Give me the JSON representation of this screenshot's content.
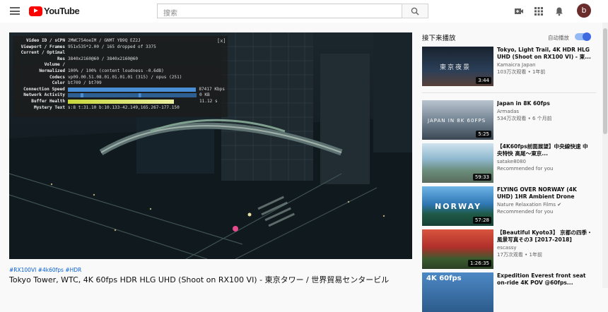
{
  "header": {
    "logo_text": "YouTube",
    "search_placeholder": "搜索",
    "avatar_letter": "b",
    "icons": [
      "menu-icon",
      "search-icon",
      "create-video-icon",
      "apps-grid-icon",
      "notifications-bell-icon"
    ]
  },
  "stats": {
    "close_label": "[x]",
    "rows": [
      {
        "key": "Video ID / sCPN",
        "value": "2MWC754oeIM / GNMT YB9Q EZ2J"
      },
      {
        "key": "Viewport / Frames",
        "value": "951x535*2.00 / 165 dropped of 3375"
      },
      {
        "key": "Current / Optimal",
        "value": ""
      },
      {
        "key": "Res",
        "value": "3840x2160@60 / 3840x2160@60"
      },
      {
        "key": "Volume /",
        "value": ""
      },
      {
        "key": "Normalized",
        "value": "100% / 100% (content loudness -0.6dB)"
      },
      {
        "key": "Codecs",
        "value": "vp09.00.51.08.01.01.01.01 (315) / opus (251)"
      },
      {
        "key": "Color",
        "value": "bt709 / bt709"
      },
      {
        "key": "Connection Speed",
        "value": "87417 Kbps"
      },
      {
        "key": "Network Activity",
        "value": "0 KB"
      },
      {
        "key": "Buffer Health",
        "value": "11.12 s"
      },
      {
        "key": "Mystery Text",
        "value": "s:8 t:31.10 b:10.133-42.149,165.267-177.150"
      }
    ],
    "connection_bar_color": "#4a8fd6",
    "network_bar_color": "#4a8fd6",
    "buffer_bar_color": "#c7d63b"
  },
  "video": {
    "hashtags": "#RX100VI #4k60fps #HDR",
    "title": "Tokyo Tower, WTC, 4K 60fps HDR HLG UHD (Shoot on RX100 VI) - 東京タワー / 世界貿易センタービル"
  },
  "sidebar": {
    "up_next": "接下来播放",
    "autoplay_label": "自动播放",
    "autoplay_on": true,
    "accent": "#3e6ae1",
    "cards": [
      {
        "title": "Tokyo, Light Trail, 4K HDR HLG UHD (Shoot on RX100 VI) - 東...",
        "channel": "Kamaicra Japan",
        "stats": "103万次观看 • 1年前",
        "duration": "3:44",
        "thumb_text": "東京夜景"
      },
      {
        "title": "Japan in 8K 60fps",
        "channel": "Armadas",
        "stats": "534万次观看 • 6 个月前",
        "duration": "5:25",
        "thumb_text": "JAPAN IN 8K 60FPS"
      },
      {
        "title": "【4K60fps前面展望】中央線快速 中央特快 高尾～東京...",
        "channel": "satake8080",
        "stats": "Recommended for you",
        "duration": "59:33",
        "thumb_text": ""
      },
      {
        "title": "FLYING OVER NORWAY (4K UHD) 1HR Ambient Drone Film...",
        "channel": "Nature Relaxation Films",
        "stats": "Recommended for you",
        "duration": "57:28",
        "thumb_text": "NORWAY"
      },
      {
        "title": "【Beautiful Kyoto3】 京都の四季・風景写真その3 [2017-2018]",
        "channel": "escassy",
        "stats": "17万次观看 • 1年前",
        "duration": "1:26:35",
        "thumb_text": ""
      },
      {
        "title": "Expedition Everest front seat on-ride 4K POV @60fps...",
        "channel": "",
        "stats": "",
        "duration": "",
        "thumb_text": "4K 60fps"
      }
    ]
  }
}
